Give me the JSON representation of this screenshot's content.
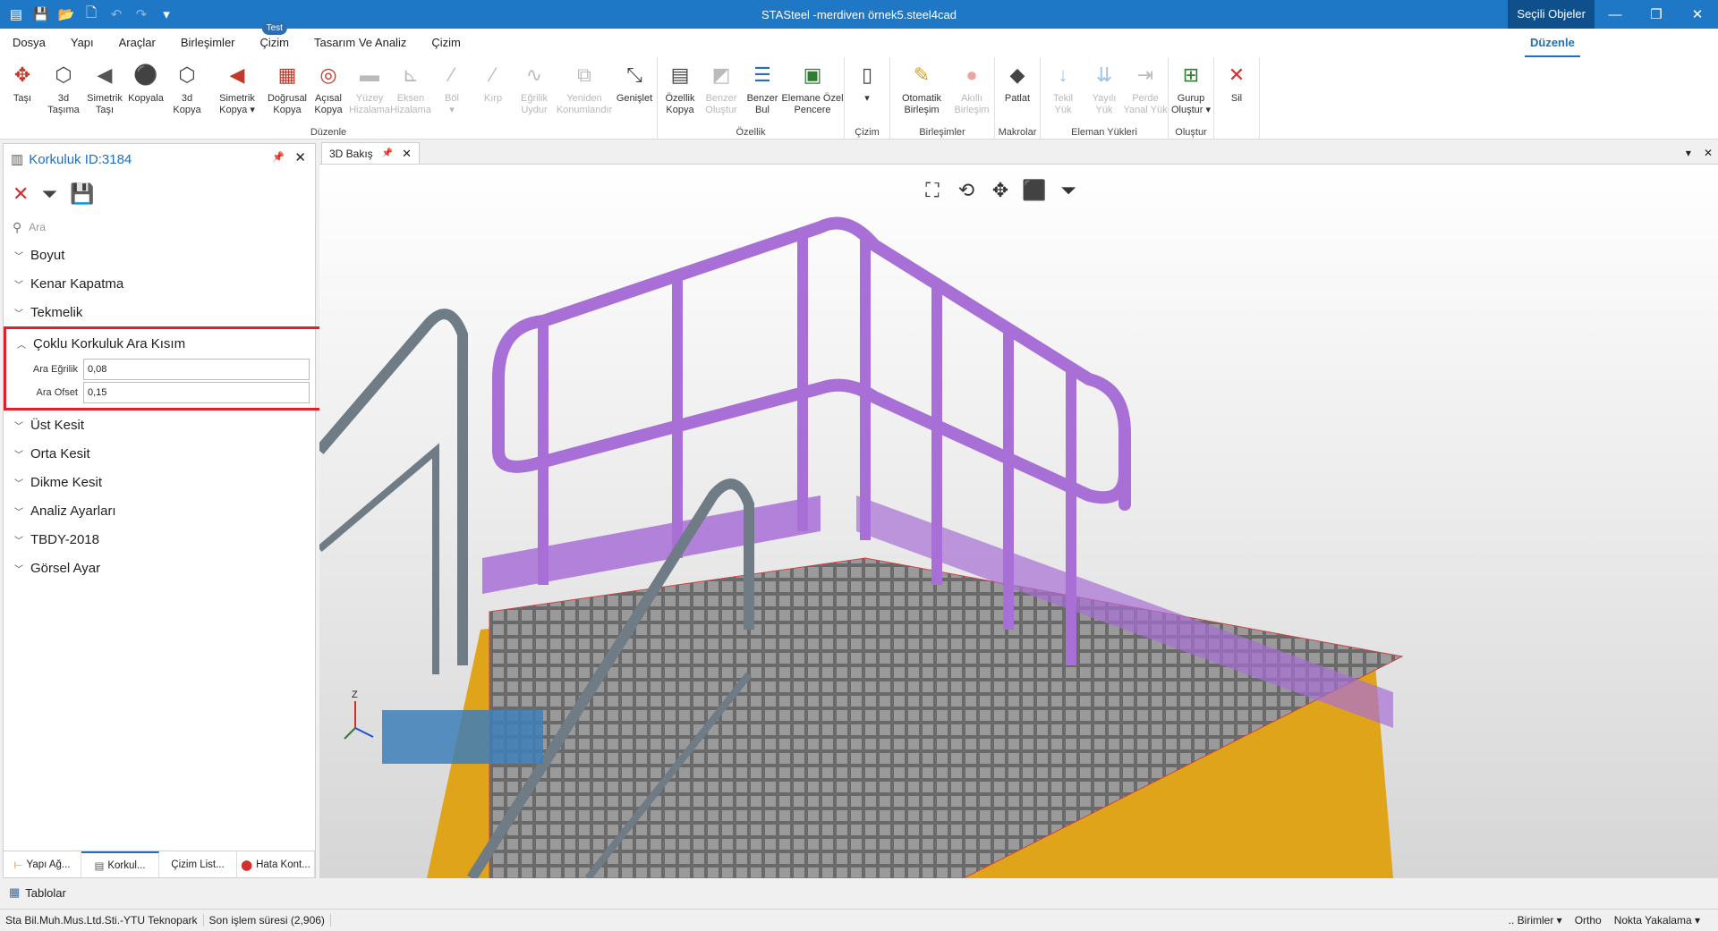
{
  "titlebar": {
    "title": "STASteel -merdiven örnek5.steel4cad",
    "selected_objects": "Seçili Objeler",
    "minimize": "—",
    "restore": "❐",
    "close": "✕"
  },
  "quick_access": [
    "menu-icon",
    "save-icon",
    "open-icon",
    "new-icon",
    "undo-icon",
    "redo-icon",
    "customize-icon"
  ],
  "menu": {
    "items": [
      "Dosya",
      "Yapı",
      "Araçlar",
      "Birleşimler",
      "Çizim",
      "Tasarım Ve Analiz",
      "Çizim"
    ],
    "badge": "Test",
    "active_tab": "Düzenle"
  },
  "ribbon": {
    "groups": [
      {
        "label": "Düzenle",
        "buttons": [
          {
            "l1": "Taşı",
            "l2": "",
            "icon": "✥",
            "color": "#c0392b",
            "disabled": false
          },
          {
            "l1": "3d",
            "l2": "Taşıma",
            "icon": "⬡",
            "color": "#444",
            "disabled": false
          },
          {
            "l1": "Simetrik",
            "l2": "Taşı",
            "icon": "◀",
            "color": "#555",
            "disabled": false
          },
          {
            "l1": "Kopyala",
            "l2": "",
            "icon": "⚫",
            "color": "#c0392b",
            "disabled": false
          },
          {
            "l1": "3d",
            "l2": "Kopya",
            "icon": "⬡",
            "color": "#444",
            "disabled": false
          },
          {
            "l1": "Simetrik",
            "l2": "Kopya ▾",
            "icon": "◀",
            "color": "#c0392b",
            "disabled": false
          },
          {
            "l1": "Doğrusal",
            "l2": "Kopya",
            "icon": "▦",
            "color": "#c0392b",
            "disabled": false
          },
          {
            "l1": "Açısal",
            "l2": "Kopya",
            "icon": "◎",
            "color": "#c0392b",
            "disabled": false
          },
          {
            "l1": "Yüzey",
            "l2": "Hizalama",
            "icon": "▬",
            "color": "#bbb",
            "disabled": true
          },
          {
            "l1": "Eksen",
            "l2": "Hizalama",
            "icon": "⊾",
            "color": "#bbb",
            "disabled": true
          },
          {
            "l1": "Böl",
            "l2": "▾",
            "icon": "⁄",
            "color": "#bbb",
            "disabled": true
          },
          {
            "l1": "Kırp",
            "l2": "",
            "icon": "⁄",
            "color": "#bbb",
            "disabled": true
          },
          {
            "l1": "Eğrilik",
            "l2": "Uydur",
            "icon": "∿",
            "color": "#bbb",
            "disabled": true
          },
          {
            "l1": "Yeniden",
            "l2": "Konumlandır",
            "icon": "⧉",
            "color": "#bbb",
            "disabled": true
          },
          {
            "l1": "Genişlet",
            "l2": "",
            "icon": "⤡",
            "color": "#444",
            "disabled": false
          }
        ]
      },
      {
        "label": "Özellik",
        "buttons": [
          {
            "l1": "Özellik",
            "l2": "Kopya",
            "icon": "▤",
            "color": "#444",
            "disabled": false
          },
          {
            "l1": "Benzer",
            "l2": "Oluştur",
            "icon": "◩",
            "color": "#bbb",
            "disabled": true
          },
          {
            "l1": "Benzer",
            "l2": "Bul",
            "icon": "☰",
            "color": "#2a6fb5",
            "disabled": false
          },
          {
            "l1": "Elemane Özel",
            "l2": "Pencere",
            "icon": "▣",
            "color": "#2e7d32",
            "disabled": false
          }
        ]
      },
      {
        "label": "Çizim",
        "buttons": [
          {
            "l1": "",
            "l2": "▾",
            "icon": "▯",
            "color": "#444",
            "disabled": false
          }
        ]
      },
      {
        "label": "Birleşimler",
        "buttons": [
          {
            "l1": "Otomatik",
            "l2": "Birleşim",
            "icon": "✎",
            "color": "#d4a017",
            "disabled": false
          },
          {
            "l1": "Akıllı",
            "l2": "Birleşim",
            "icon": "●",
            "color": "#e8a7a0",
            "disabled": true
          }
        ]
      },
      {
        "label": "Makrolar",
        "buttons": [
          {
            "l1": "Patlat",
            "l2": "",
            "icon": "◆",
            "color": "#444",
            "disabled": false
          }
        ]
      },
      {
        "label": "Eleman Yükleri",
        "buttons": [
          {
            "l1": "Tekil",
            "l2": "Yük",
            "icon": "↓",
            "color": "#9ec3e6",
            "disabled": true
          },
          {
            "l1": "Yayılı",
            "l2": "Yük",
            "icon": "⇊",
            "color": "#9ec3e6",
            "disabled": true
          },
          {
            "l1": "Perde",
            "l2": "Yanal Yük",
            "icon": "⇥",
            "color": "#bbb",
            "disabled": true
          }
        ]
      },
      {
        "label": "Oluştur",
        "buttons": [
          {
            "l1": "Gurup",
            "l2": "Oluştur ▾",
            "icon": "⊞",
            "color": "#2e7d32",
            "disabled": false
          }
        ]
      },
      {
        "label": "",
        "buttons": [
          {
            "l1": "Sil",
            "l2": "",
            "icon": "✕",
            "color": "#d32f2f",
            "disabled": false
          }
        ]
      }
    ]
  },
  "left_panel": {
    "title": "Korkuluk ID:3184",
    "search_placeholder": "Ara",
    "categories_top": [
      "Boyut",
      "Kenar Kapatma",
      "Tekmelik"
    ],
    "open_category": "Çoklu Korkuluk Ara Kısım",
    "properties": [
      {
        "label": "Ara Eğrilik",
        "value": "0,08"
      },
      {
        "label": "Ara Ofset",
        "value": "0,15"
      }
    ],
    "categories_bottom": [
      "Üst Kesit",
      "Orta Kesit",
      "Dikme Kesit",
      "Analiz Ayarları",
      "TBDY-2018",
      "Görsel Ayar"
    ],
    "tabs": [
      "Yapı Ağ...",
      "Korkul...",
      "Çizim List...",
      "Hata Kont..."
    ]
  },
  "viewport": {
    "tab": "3D Bakış",
    "axis_z": "Z"
  },
  "bottom": {
    "tablolar": "Tablolar",
    "company": "Sta Bil.Muh.Mus.Ltd.Sti.-YTU Teknopark",
    "last_op": "Son işlem süresi (2,906)",
    "right": [
      ".. Birimler ▾",
      "Ortho",
      "Nokta Yakalama ▾"
    ]
  }
}
